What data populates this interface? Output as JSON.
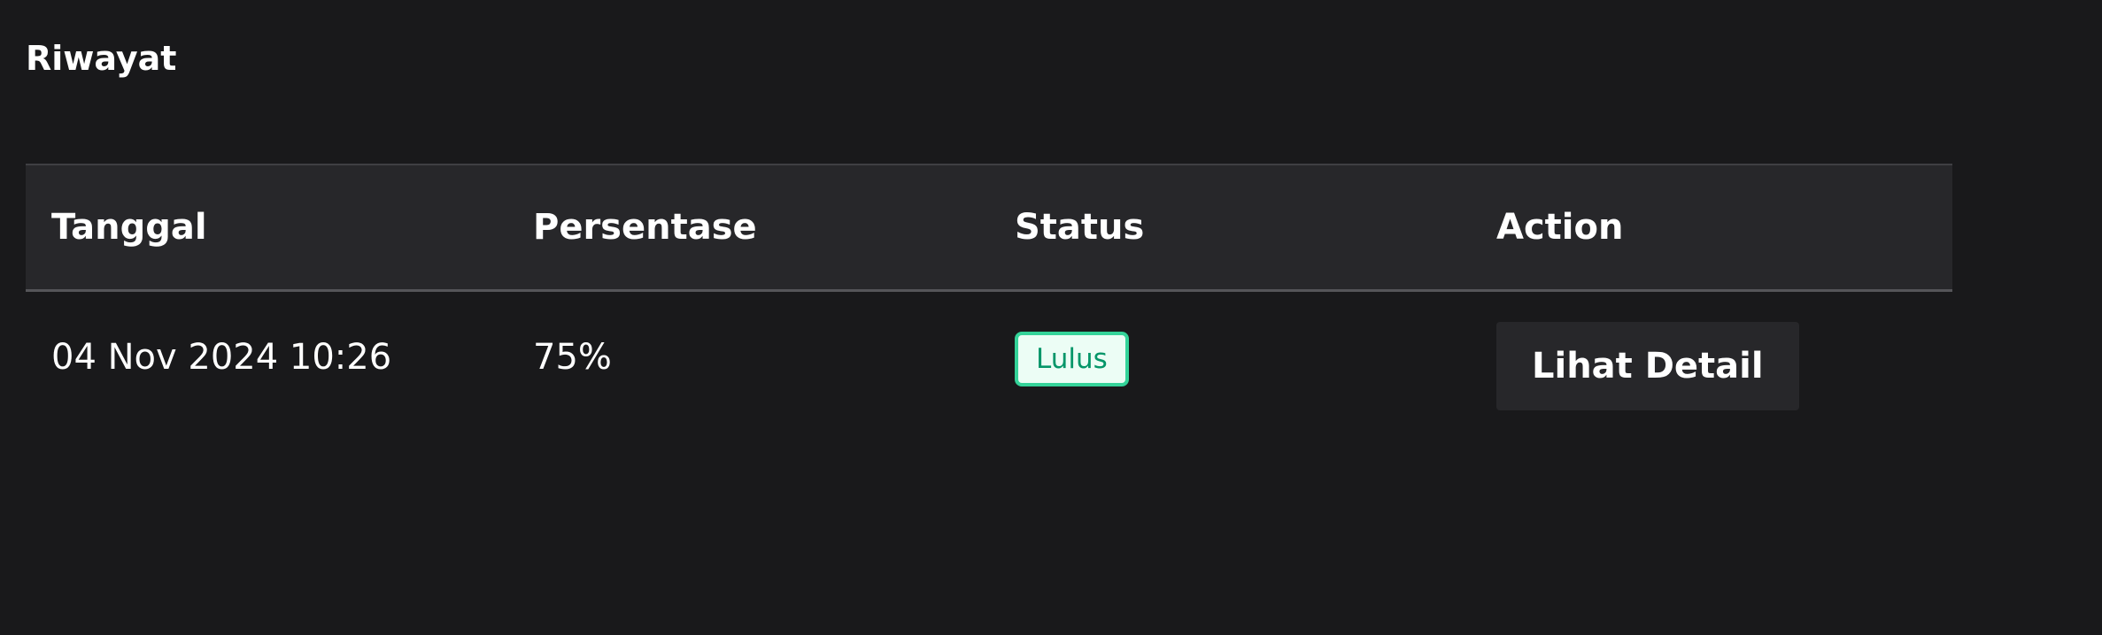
{
  "page": {
    "title": "Riwayat"
  },
  "table": {
    "headers": {
      "date": "Tanggal",
      "percentage": "Persentase",
      "status": "Status",
      "action": "Action"
    },
    "rows": [
      {
        "date": "04 Nov 2024 10:26",
        "percentage": "75%",
        "status": "Lulus",
        "action_label": "Lihat Detail"
      }
    ]
  },
  "colors": {
    "background": "#19191b",
    "header_background": "#27272a",
    "status_pass_text": "#059669",
    "status_pass_border": "#34d399",
    "status_pass_background": "#ecfdf5"
  }
}
